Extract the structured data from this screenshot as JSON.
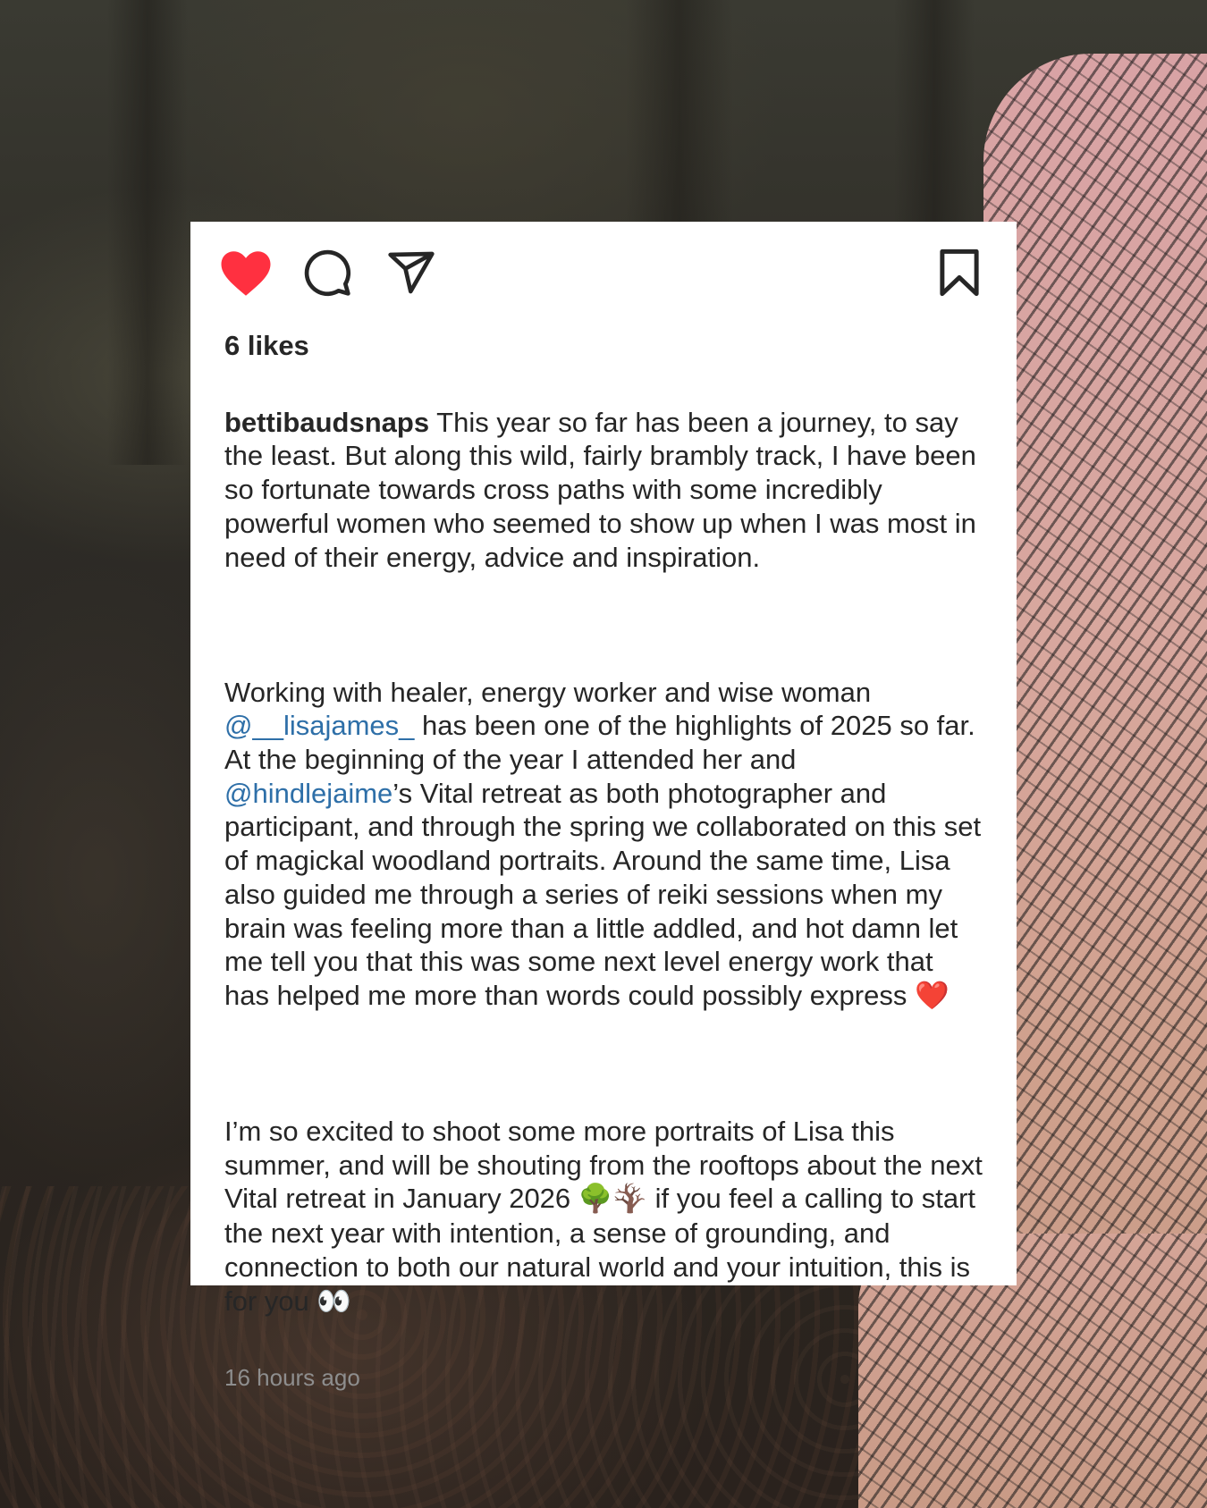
{
  "post": {
    "likes": "6 likes",
    "username": "bettibaudsnaps",
    "caption_p1": "This year so far has been a journey, to say the least. But along this wild, fairly brambly track, I have been so fortunate towards cross paths with some incredibly powerful women who seemed to show up when I was most in need of their energy, advice and inspiration.",
    "caption_p2_a": "Working with healer, energy worker and wise woman ",
    "mention_1": "@__lisajames_",
    "caption_p2_b": " has been one of the highlights of 2025 so far. At the beginning of the year I attended her and ",
    "mention_2": "@hindlejaime",
    "caption_p2_c": "’s Vital retreat as both photographer and participant, and through the spring we collaborated on this set of magickal woodland portraits. Around the same time, Lisa also guided me through a series of reiki sessions when my brain was feeling more than a little addled, and hot damn let me tell you that this was some next level energy work that has helped me more than words could possibly express ",
    "emoji_heart": "❤️",
    "caption_p3_a": "I’m so excited to shoot some more portraits of Lisa this summer, and will be shouting from the rooftops about the next Vital retreat in January 2026 ",
    "emoji_trees": "🌳🪾",
    "caption_p3_b": " if you feel a calling to start the next year with intention, a sense of grounding, and connection to both our natural world and your intuition, this is for you ",
    "emoji_eyes": "👀",
    "timestamp": "16 hours ago"
  },
  "icons": {
    "like": "heart-icon",
    "comment": "comment-icon",
    "share": "share-icon",
    "save": "bookmark-icon"
  },
  "colors": {
    "heart": "#ff3040",
    "text": "#262626",
    "mention": "#2e6fa8",
    "timestamp": "#8e8e8e",
    "card": "#ffffff"
  }
}
